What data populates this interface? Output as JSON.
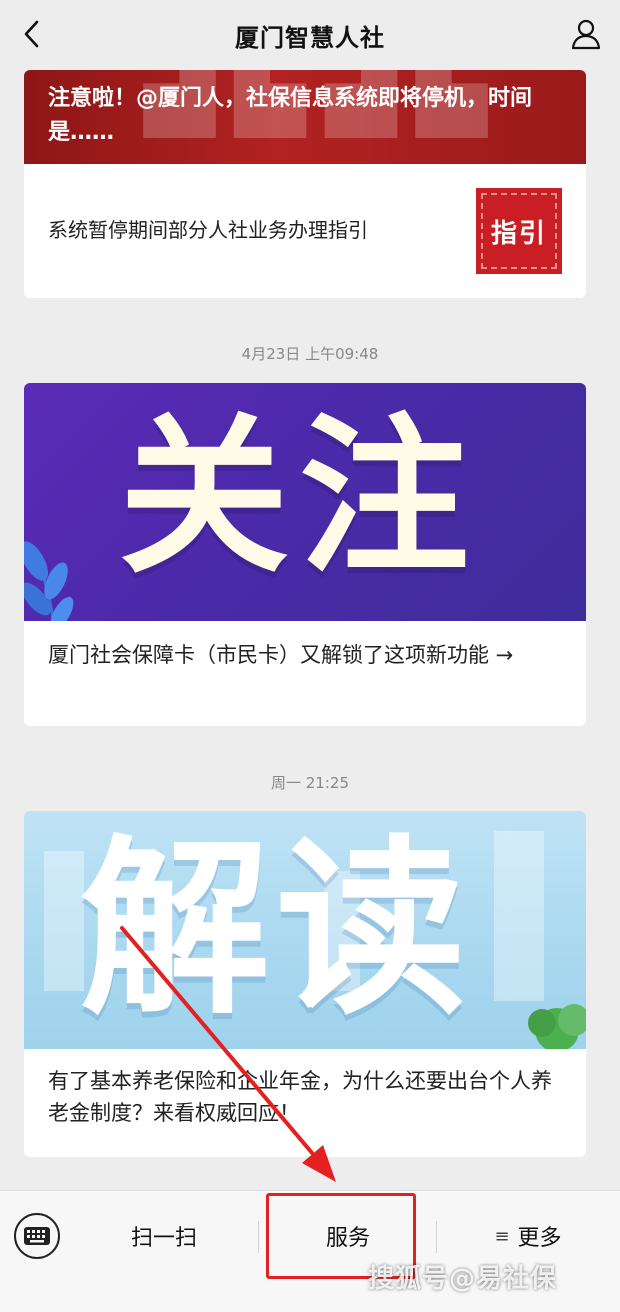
{
  "header": {
    "title": "厦门智慧人社",
    "back_icon": "back-chevron-icon",
    "profile_icon": "user-profile-icon"
  },
  "feed": {
    "article1": {
      "title": "注意啦！@厦门人，社保信息系统即将停机，时间是……",
      "sub_title": "系统暂停期间部分人社业务办理指引",
      "thumb_label": "指引"
    },
    "timestamp2": "4月23日 上午09:48",
    "article2": {
      "banner_text": "关注",
      "title": "厦门社会保障卡（市民卡）又解锁了这项新功能 →"
    },
    "timestamp3": "周一 21:25",
    "article3": {
      "banner_text": "解读",
      "title": "有了基本养老保险和企业年金，为什么还要出台个人养老金制度？来看权威回应！"
    }
  },
  "bottom_menu": {
    "keyboard_icon": "keyboard-icon",
    "scan_label": "扫一扫",
    "service_label": "服务",
    "more_label": "更多"
  },
  "watermark": "搜狐号@易社保",
  "colors": {
    "background": "#ededed",
    "annotation_red": "#e52020",
    "banner1_red": "#b22222",
    "banner2_purple": "#4a2aa8",
    "banner3_blue": "#a9d8f0"
  }
}
